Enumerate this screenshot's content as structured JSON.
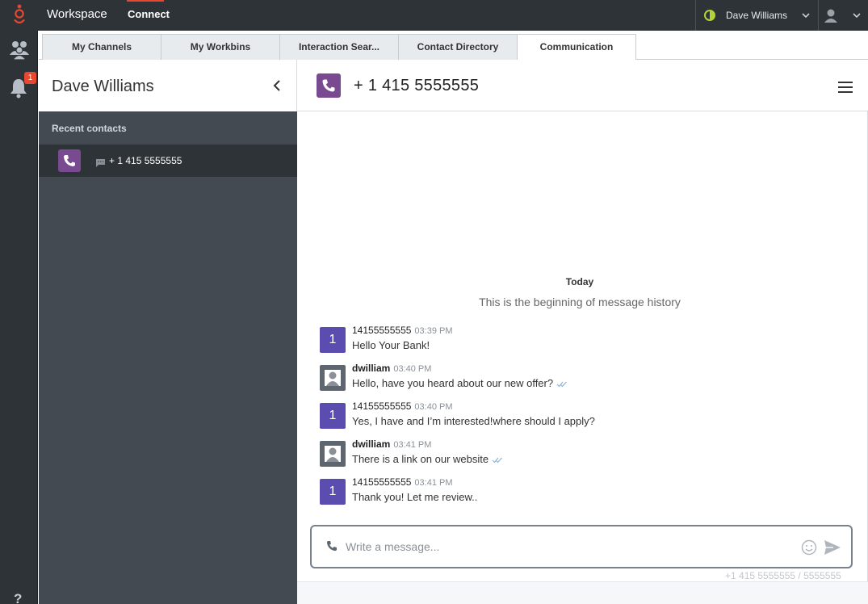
{
  "topbar": {
    "app_title": "Workspace",
    "active_tab": "Connect",
    "user_name": "Dave Williams",
    "status_color": "#b2d235",
    "accent_color": "#e8482f"
  },
  "rail": {
    "notification_count": "1",
    "help_label": "?"
  },
  "tabs": [
    {
      "label": "My Channels"
    },
    {
      "label": "My Workbins"
    },
    {
      "label": "Interaction Sear..."
    },
    {
      "label": "Contact Directory"
    },
    {
      "label": "Communication"
    }
  ],
  "contacts": {
    "title": "Dave Williams",
    "recent_label": "Recent contacts",
    "items": [
      {
        "name": "+ 1 415 5555555",
        "icon": "phone-icon",
        "channel_icon": "chat-icon"
      }
    ]
  },
  "conversation": {
    "title": "+ 1 415 5555555",
    "day_label": "Today",
    "history_label": "This is the beginning of message history",
    "messages": [
      {
        "sender": "14155555555",
        "time": "03:39 PM",
        "text": "Hello Your Bank!",
        "avatar": "1"
      },
      {
        "sender": "dwilliam",
        "time": "03:40 PM",
        "text": "Hello, have you heard about our new offer?",
        "avatar": "agent-icon"
      },
      {
        "sender": "14155555555",
        "time": "03:40 PM",
        "text": "Yes, I have and I’m interested!where should I apply?",
        "avatar": "1"
      },
      {
        "sender": "dwilliam",
        "time": "03:41 PM",
        "text": "There is a link on our website",
        "avatar": "agent-icon"
      },
      {
        "sender": "14155555555",
        "time": "03:41 PM",
        "text": "Thank you! Let me review..",
        "avatar": "1"
      }
    ],
    "composer_placeholder": "Write a message...",
    "channel_info": "+1 415 5555555 / 5555555"
  }
}
